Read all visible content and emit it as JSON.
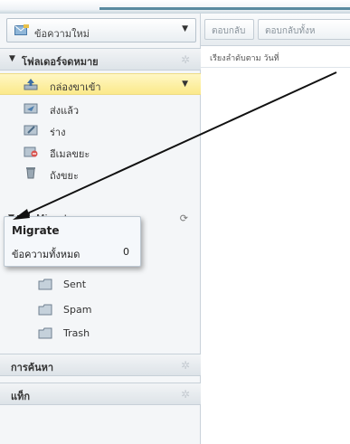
{
  "new_message": {
    "label": "ข้อความใหม่"
  },
  "toolbar": {
    "reply_label": "ตอบกลับ",
    "reply_all_label": "ตอบกลับทั้งห"
  },
  "sort": {
    "label": "เรียงลำดับตาม วันที่"
  },
  "sections": {
    "folders_title": "โฟลเดอร์จดหมาย",
    "search_title": "การค้นหา",
    "tags_title": "แท็ก"
  },
  "folders": [
    {
      "label": "กล่องขาเข้า"
    },
    {
      "label": "ส่งแล้ว"
    },
    {
      "label": "ร่าง"
    },
    {
      "label": "อีเมลขยะ"
    },
    {
      "label": "ถังขยะ"
    }
  ],
  "migrate": {
    "label": "Migrate",
    "children": [
      {
        "label": "Sent"
      },
      {
        "label": "Spam"
      },
      {
        "label": "Trash"
      }
    ]
  },
  "tooltip": {
    "title": "Migrate",
    "total_label": "ข้อความทั้งหมด",
    "total_count": "0"
  },
  "colors": {
    "inbox_highlight": "#fbe98a",
    "accent": "#5a8aa0"
  }
}
